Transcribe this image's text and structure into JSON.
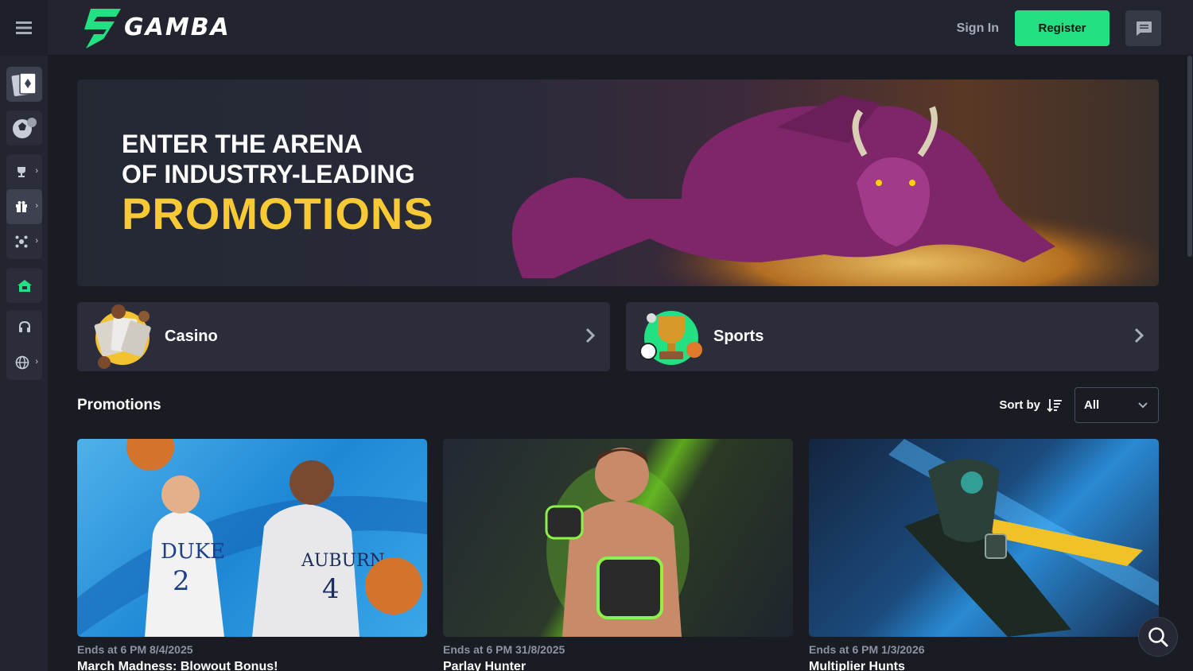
{
  "header": {
    "logo_text": "GAMBA",
    "signin_label": "Sign In",
    "register_label": "Register"
  },
  "hero": {
    "line1": "ENTER THE ARENA",
    "line2": "OF INDUSTRY-LEADING",
    "line3": "PROMOTIONS"
  },
  "categories": [
    {
      "label": "Casino"
    },
    {
      "label": "Sports"
    }
  ],
  "promotions": {
    "title": "Promotions",
    "sort_label": "Sort by",
    "sort_value": "All",
    "cards": [
      {
        "date": "Ends at 6 PM 8/4/2025",
        "name": "March Madness: Blowout Bonus!"
      },
      {
        "date": "Ends at 6 PM 31/8/2025",
        "name": "Parlay Hunter"
      },
      {
        "date": "Ends at 6 PM 1/3/2026",
        "name": "Multiplier Hunts"
      }
    ]
  },
  "colors": {
    "accent": "#23e083",
    "hero_highlight": "#f6c935",
    "background": "#1a1c24",
    "panel": "#2b2e3a"
  },
  "icons": [
    "menu-icon",
    "chat-icon",
    "casino-icon",
    "sports-icon",
    "trophy-icon",
    "gift-icon",
    "network-icon",
    "house-icon",
    "headset-icon",
    "globe-icon",
    "sort-icon",
    "chevron-down-icon",
    "chevron-right-icon",
    "search-icon"
  ]
}
